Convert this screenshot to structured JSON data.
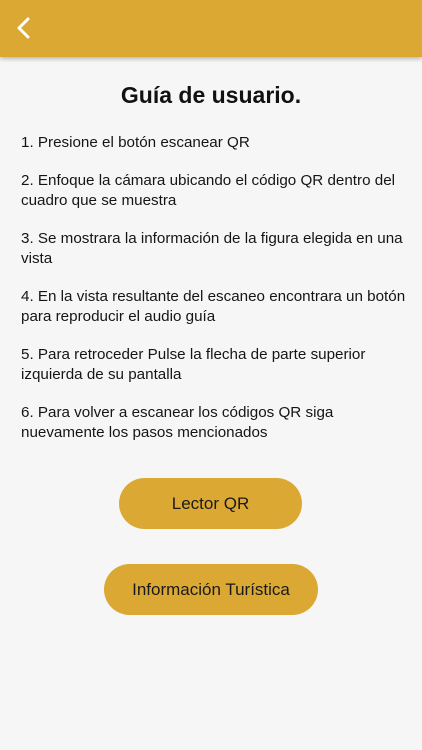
{
  "header": {
    "back_icon": "chevron-left-icon",
    "color": "#dba834"
  },
  "guide": {
    "title": "Guía de usuario.",
    "steps": [
      "1. Presione el botón escanear QR",
      "2. Enfoque la cámara ubicando el código QR dentro del cuadro que se muestra",
      "3. Se mostrara la información de la figura elegida en una vista",
      "4. En la vista resultante del escaneo encontrara un botón para reproducir el audio guía",
      "5. Para retroceder Pulse la flecha de parte superior izquierda de su pantalla",
      "6. Para volver a escanear los códigos QR siga nuevamente los pasos mencionados"
    ]
  },
  "buttons": {
    "qr_reader": "Lector QR",
    "tourist_info": "Información Turística"
  }
}
